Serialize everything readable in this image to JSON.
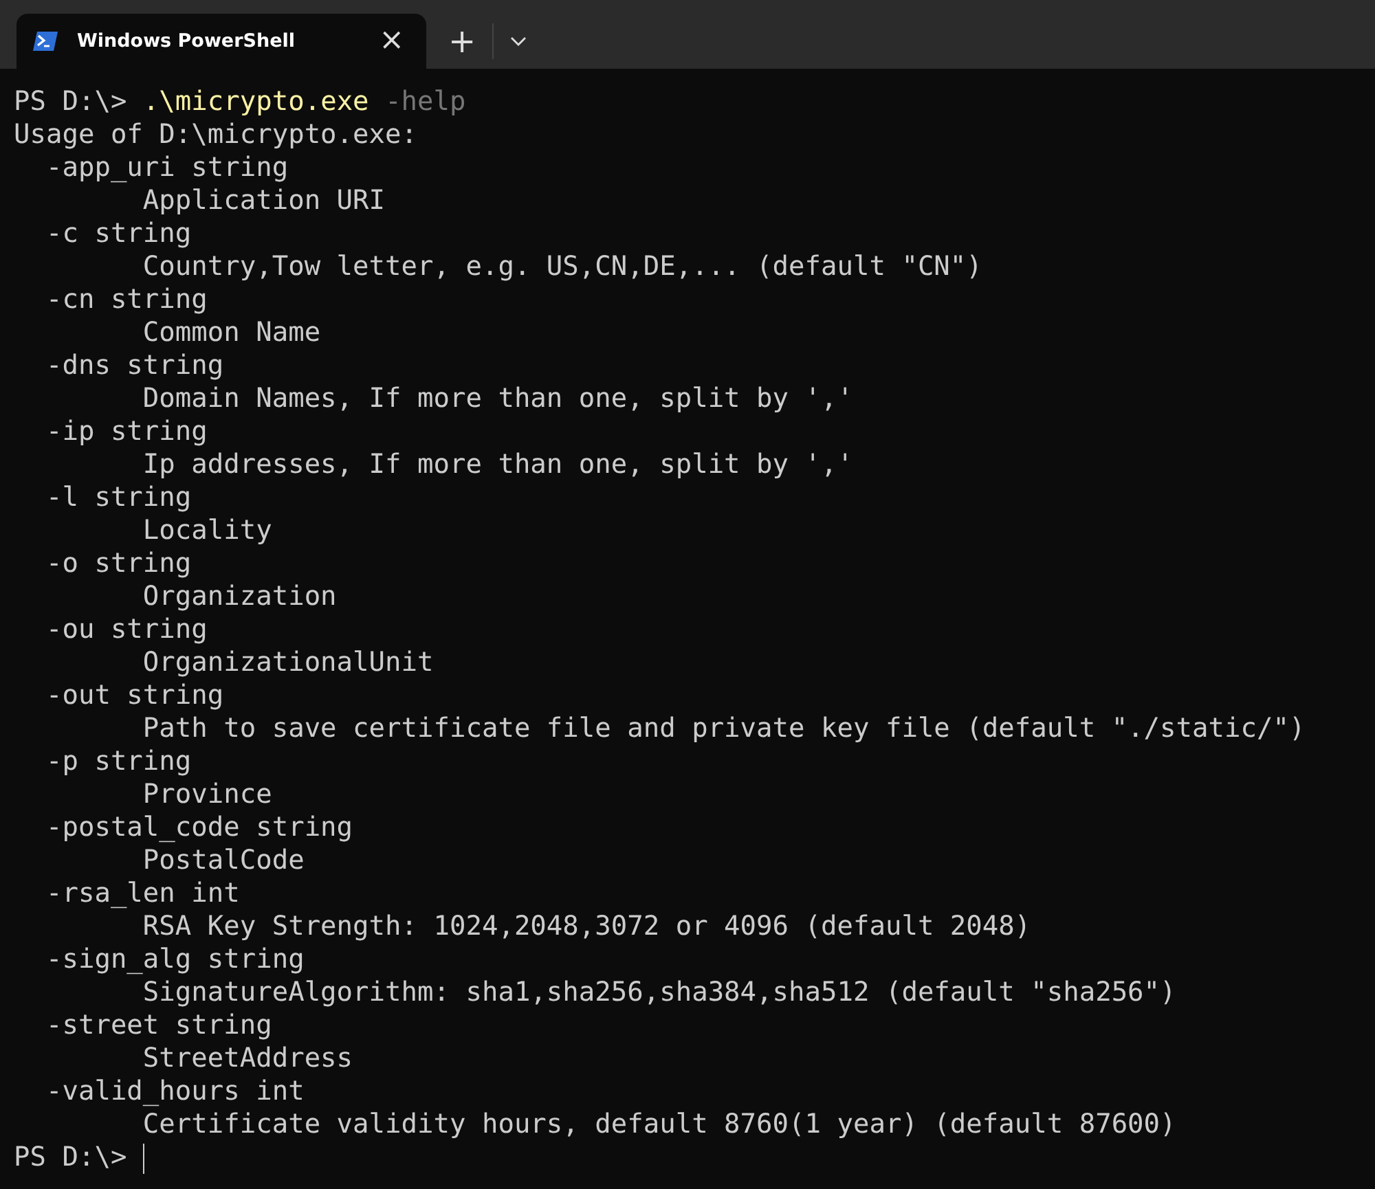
{
  "tab": {
    "title": "Windows PowerShell",
    "close": "×",
    "new_tab": "+"
  },
  "terminal": {
    "lines": [
      {
        "kind": "prompt",
        "prompt": "PS D:\\>",
        "command": ".\\micrypto.exe",
        "args": "-help"
      },
      {
        "kind": "output",
        "text": "Usage of D:\\micrypto.exe:"
      },
      {
        "kind": "output",
        "text": "  -app_uri string"
      },
      {
        "kind": "output",
        "text": "        Application URI"
      },
      {
        "kind": "output",
        "text": "  -c string"
      },
      {
        "kind": "output",
        "text": "        Country,Tow letter, e.g. US,CN,DE,... (default \"CN\")"
      },
      {
        "kind": "output",
        "text": "  -cn string"
      },
      {
        "kind": "output",
        "text": "        Common Name"
      },
      {
        "kind": "output",
        "text": "  -dns string"
      },
      {
        "kind": "output",
        "text": "        Domain Names, If more than one, split by ','"
      },
      {
        "kind": "output",
        "text": "  -ip string"
      },
      {
        "kind": "output",
        "text": "        Ip addresses, If more than one, split by ','"
      },
      {
        "kind": "output",
        "text": "  -l string"
      },
      {
        "kind": "output",
        "text": "        Locality"
      },
      {
        "kind": "output",
        "text": "  -o string"
      },
      {
        "kind": "output",
        "text": "        Organization"
      },
      {
        "kind": "output",
        "text": "  -ou string"
      },
      {
        "kind": "output",
        "text": "        OrganizationalUnit"
      },
      {
        "kind": "output",
        "text": "  -out string"
      },
      {
        "kind": "output",
        "text": "        Path to save certificate file and private key file (default \"./static/\")"
      },
      {
        "kind": "output",
        "text": "  -p string"
      },
      {
        "kind": "output",
        "text": "        Province"
      },
      {
        "kind": "output",
        "text": "  -postal_code string"
      },
      {
        "kind": "output",
        "text": "        PostalCode"
      },
      {
        "kind": "output",
        "text": "  -rsa_len int"
      },
      {
        "kind": "output",
        "text": "        RSA Key Strength: 1024,2048,3072 or 4096 (default 2048)"
      },
      {
        "kind": "output",
        "text": "  -sign_alg string"
      },
      {
        "kind": "output",
        "text": "        SignatureAlgorithm: sha1,sha256,sha384,sha512 (default \"sha256\")"
      },
      {
        "kind": "output",
        "text": "  -street string"
      },
      {
        "kind": "output",
        "text": "        StreetAddress"
      },
      {
        "kind": "output",
        "text": "  -valid_hours int"
      },
      {
        "kind": "output",
        "text": "        Certificate validity hours, default 8760(1 year) (default 87600)"
      },
      {
        "kind": "cursor",
        "prompt": "PS D:\\>"
      }
    ]
  }
}
